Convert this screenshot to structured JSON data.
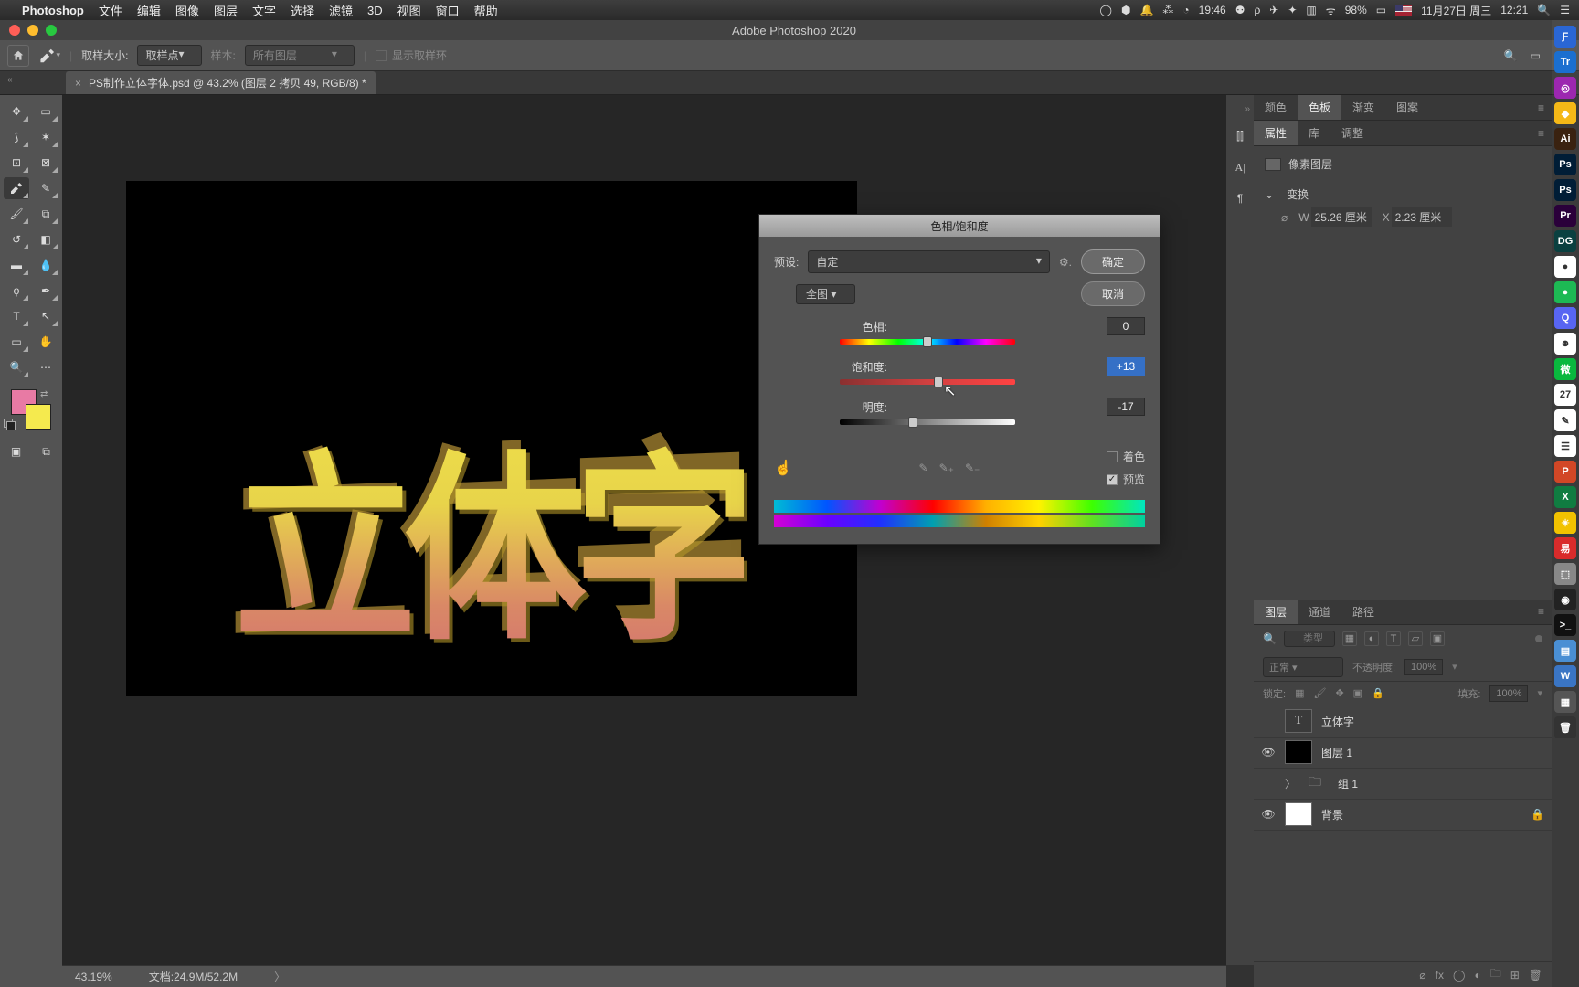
{
  "menubar": {
    "app": "Photoshop",
    "items": [
      "文件",
      "编辑",
      "图像",
      "图层",
      "文字",
      "选择",
      "滤镜",
      "3D",
      "视图",
      "窗口",
      "帮助"
    ],
    "clock1": "19:46",
    "battery": "98%",
    "date": "11月27日 周三",
    "clock2": "12:21"
  },
  "window": {
    "title": "Adobe Photoshop 2020"
  },
  "options": {
    "sample_size_label": "取样大小:",
    "sample_size_value": "取样点",
    "sample_label": "样本:",
    "sample_value": "所有图层",
    "show_ring": "显示取样环"
  },
  "doc_tab": {
    "name": "PS制作立体字体.psd @ 43.2% (图层 2 拷贝 49, RGB/8) *"
  },
  "canvas_text": "立体字",
  "status": {
    "zoom": "43.19%",
    "docinfo": "文档:24.9M/52.2M"
  },
  "right_tabs_a": [
    "颜色",
    "色板",
    "渐变",
    "图案"
  ],
  "right_tabs_b": [
    "属性",
    "库",
    "调整"
  ],
  "properties": {
    "pixel_layer": "像素图层",
    "transform_hdr": "变换",
    "w_label": "W",
    "w_value": "25.26 厘米",
    "x_label": "X",
    "x_value": "2.23 厘米"
  },
  "dialog": {
    "title": "色相/饱和度",
    "preset_label": "预设:",
    "preset_value": "自定",
    "ok": "确定",
    "cancel": "取消",
    "scope": "全图",
    "hue_label": "色相:",
    "hue_value": "0",
    "sat_label": "饱和度:",
    "sat_value": "+13",
    "light_label": "明度:",
    "light_value": "-17",
    "colorize": "着色",
    "preview": "预览"
  },
  "layers_tabs": [
    "图层",
    "通道",
    "路径"
  ],
  "layers": {
    "search_ph": "类型",
    "blend_label": "正常",
    "opacity_label": "不透明度:",
    "opacity_value": "100%",
    "lock_label": "锁定:",
    "fill_label": "填充:",
    "fill_value": "100%",
    "items": [
      {
        "eye": false,
        "kind": "T",
        "name": "立体字"
      },
      {
        "eye": true,
        "kind": "black",
        "name": "图层 1"
      },
      {
        "eye": false,
        "kind": "folder",
        "name": "组 1"
      },
      {
        "eye": true,
        "kind": "white",
        "name": "背景",
        "locked": true
      }
    ]
  },
  "dock": [
    {
      "bg": "#2a66d4",
      "t": "Ƒ"
    },
    {
      "bg": "#1b6fd0",
      "t": "Tr"
    },
    {
      "bg": "#9c27b0",
      "t": "◎"
    },
    {
      "bg": "#f5b817",
      "t": "◆"
    },
    {
      "bg": "#3a2210",
      "t": "Ai"
    },
    {
      "bg": "#001d36",
      "t": "Ps"
    },
    {
      "bg": "#001d36",
      "t": "Ps"
    },
    {
      "bg": "#2a003a",
      "t": "Pr"
    },
    {
      "bg": "#0a4040",
      "t": "DG"
    },
    {
      "bg": "#ffffff",
      "t": "●"
    },
    {
      "bg": "#1db954",
      "t": "●"
    },
    {
      "bg": "#5865f2",
      "t": "Q"
    },
    {
      "bg": "#ffffff",
      "t": "☻"
    },
    {
      "bg": "#09b83e",
      "t": "微"
    },
    {
      "bg": "#ffffff",
      "t": "27"
    },
    {
      "bg": "#ffffff",
      "t": "✎"
    },
    {
      "bg": "#ffffff",
      "t": "☰"
    },
    {
      "bg": "#d24726",
      "t": "P"
    },
    {
      "bg": "#107c41",
      "t": "X"
    },
    {
      "bg": "#f2c200",
      "t": "☀"
    },
    {
      "bg": "#d92b2b",
      "t": "易"
    },
    {
      "bg": "#888888",
      "t": "⬚"
    },
    {
      "bg": "#222222",
      "t": "◉"
    },
    {
      "bg": "#111111",
      "t": ">_"
    },
    {
      "bg": "#4a8fd4",
      "t": "▤"
    },
    {
      "bg": "#3a75c4",
      "t": "W"
    },
    {
      "bg": "#555555",
      "t": "▦"
    },
    {
      "bg": "#333333",
      "t": "🗑"
    }
  ]
}
